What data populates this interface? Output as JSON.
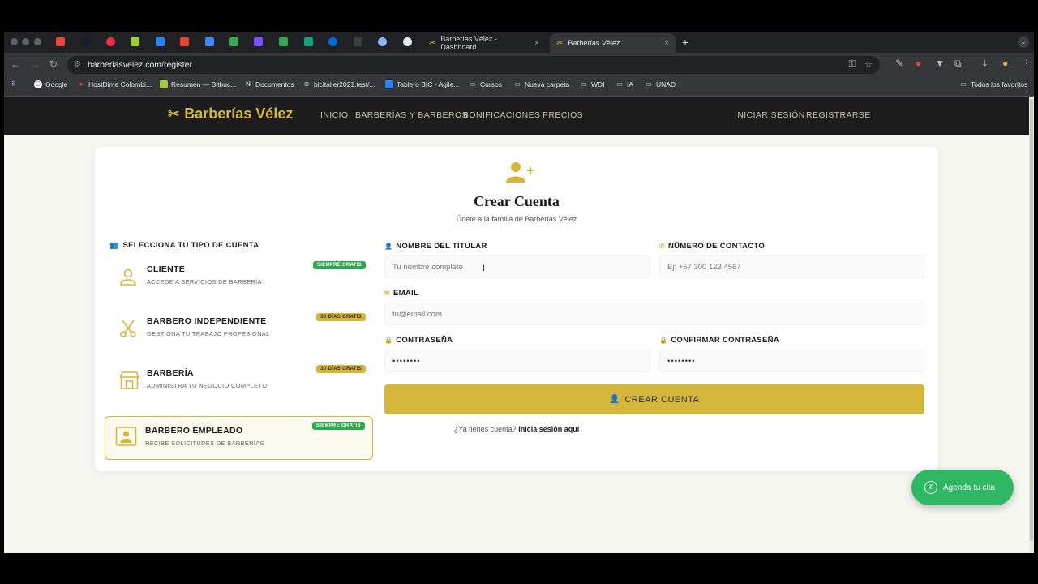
{
  "browser": {
    "tabs": [
      {
        "title": "Barberías Vélez - Dashboard",
        "close": "×"
      },
      {
        "title": "Barberías Vélez",
        "close": "×"
      }
    ],
    "new_tab": "+",
    "url": "barberiasvelez.com/register",
    "bookmarks": [
      {
        "label": "Google",
        "icon": "google-icon"
      },
      {
        "label": "HostDime Colombi...",
        "icon": "hostdime-icon"
      },
      {
        "label": "Resumen — Bitbuc...",
        "icon": "bitbucket-icon"
      },
      {
        "label": "Documentos",
        "icon": "notion-icon"
      },
      {
        "label": "bicitaller2021.test/...",
        "icon": "globe-icon"
      },
      {
        "label": "Tablero BIC - Agile...",
        "icon": "jira-icon"
      },
      {
        "label": "Cursos",
        "icon": "folder-icon"
      },
      {
        "label": "Nueva carpeta",
        "icon": "folder-icon"
      },
      {
        "label": "WDI",
        "icon": "folder-icon"
      },
      {
        "label": "IA",
        "icon": "folder-icon"
      },
      {
        "label": "UNAD",
        "icon": "folder-icon"
      }
    ],
    "all_bookmarks": "Todos los favoritos"
  },
  "site": {
    "logo": "Barberías Vélez",
    "nav": [
      "INICIO",
      "BARBERÍAS Y BARBEROS",
      "BONIFICACIONES",
      "PRECIOS"
    ],
    "auth": {
      "login": "INICIAR SESIÓN",
      "register": "REGISTRARSE"
    }
  },
  "form": {
    "title": "Crear Cuenta",
    "subtitle": "Únete a la familia de Barberías Vélez",
    "account_section": "SELECCIONA TU TIPO DE CUENTA",
    "account_types": [
      {
        "name": "CLIENTE",
        "desc": "ACCEDE A SERVICIOS DE BARBERÍA",
        "badge": "SIEMPRE GRATIS",
        "badge_color": "#2fa84f",
        "selected": false,
        "icon": "user-icon"
      },
      {
        "name": "BARBERO INDEPENDIENTE",
        "desc": "GESTIONA TU TRABAJO PROFESIONAL",
        "badge": "30 DÍAS GRATIS",
        "badge_color": "#d4b63c",
        "selected": false,
        "icon": "scissors-icon"
      },
      {
        "name": "BARBERÍA",
        "desc": "ADMINISTRA TU NEGOCIO COMPLETO",
        "badge": "30 DÍAS GRATIS",
        "badge_color": "#d4b63c",
        "selected": false,
        "icon": "store-icon"
      },
      {
        "name": "BARBERO EMPLEADO",
        "desc": "RECIBE SOLICITUDES DE BARBERÍAS",
        "badge": "SIEMPRE GRATIS",
        "badge_color": "#2fa84f",
        "selected": true,
        "icon": "id-card-icon"
      }
    ],
    "fields": {
      "name_label": "NOMBRE DEL TITULAR",
      "name_placeholder": "Tu nombre completo",
      "phone_label": "NÚMERO DE CONTACTO",
      "phone_placeholder": "Ej: +57 300 123 4567",
      "email_label": "EMAIL",
      "email_placeholder": "tu@email.com",
      "password_label": "CONTRASEÑA",
      "password_value": "••••••••",
      "confirm_label": "CONFIRMAR CONTRASEÑA",
      "confirm_value": "••••••••"
    },
    "submit": "CREAR CUENTA",
    "login_prompt": "¿Ya tienes cuenta?",
    "login_link": "Inicia sesión aquí"
  },
  "whatsapp": {
    "label": "Agenda tu cita"
  },
  "colors": {
    "accent": "#d4b63c",
    "header": "#1c1c1c",
    "green": "#2fa84f",
    "whatsapp": "#2fb864"
  }
}
